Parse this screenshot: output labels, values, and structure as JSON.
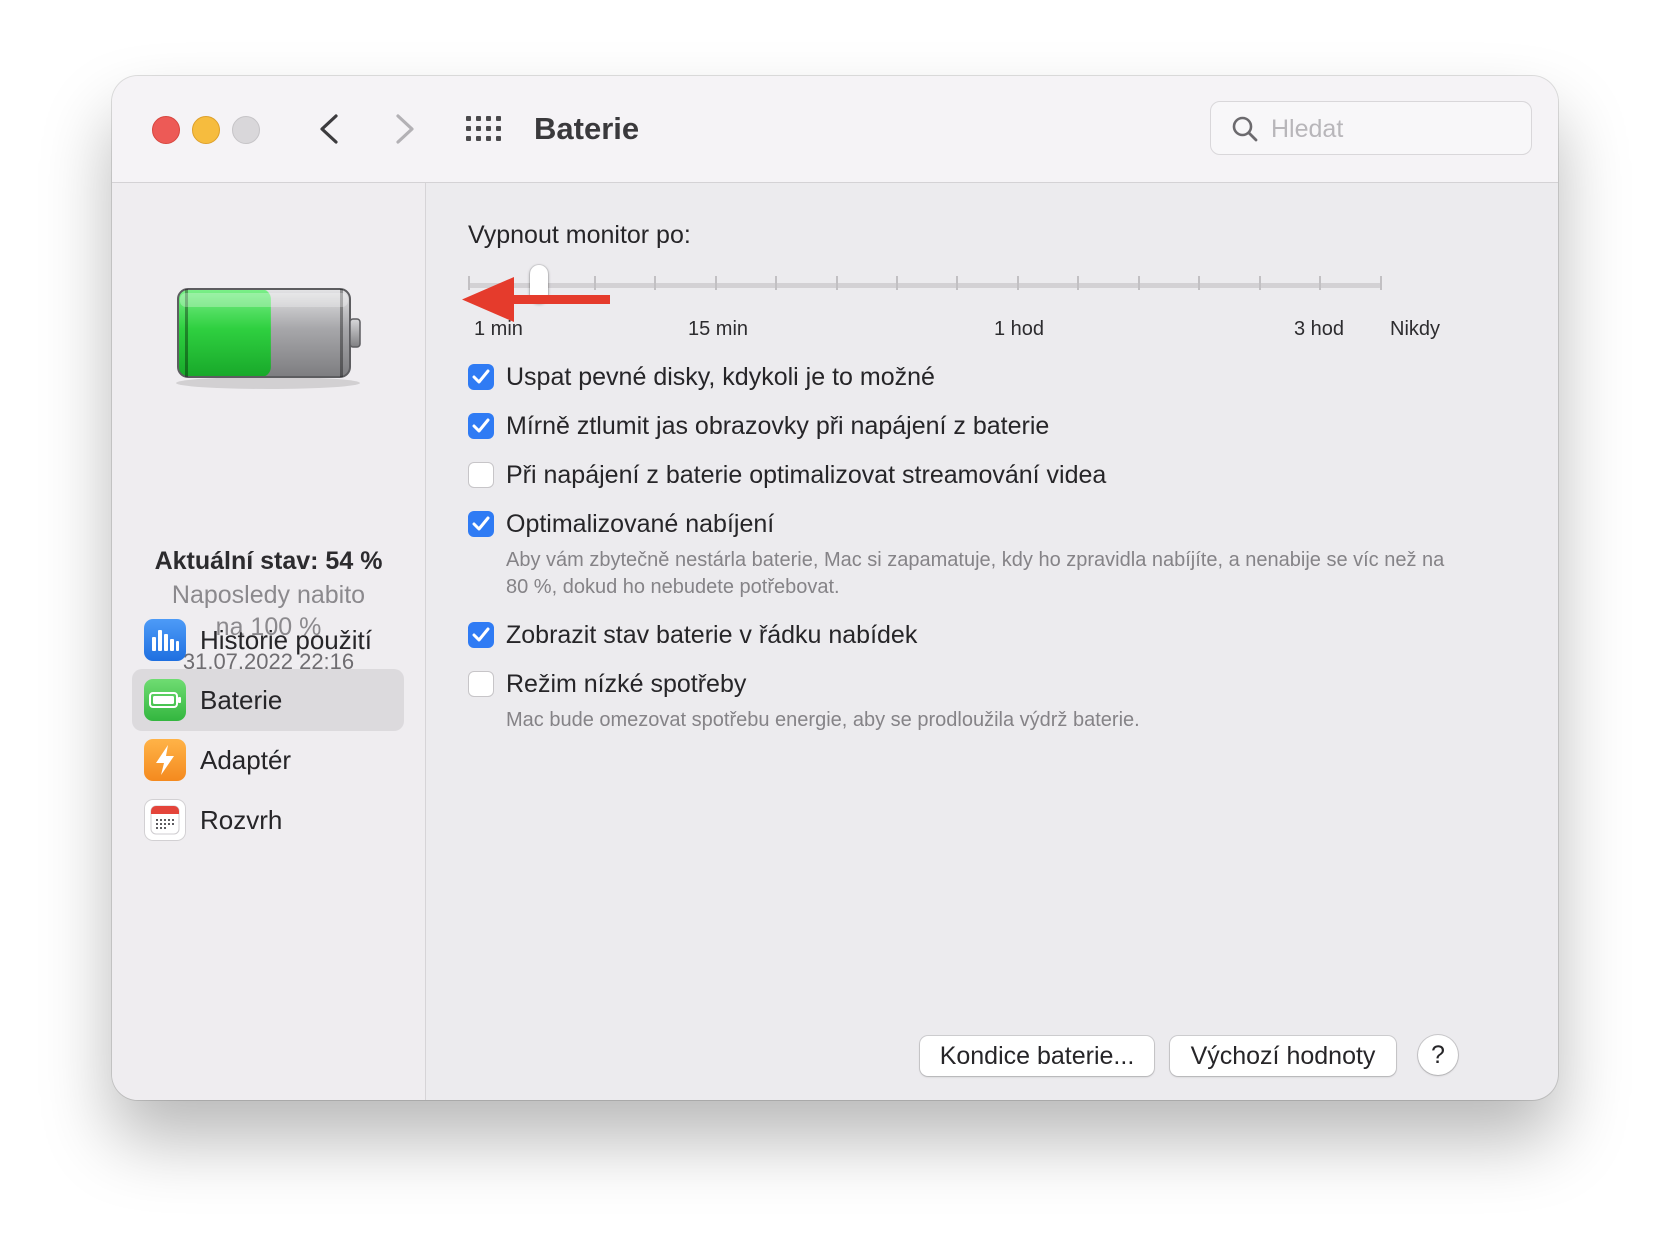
{
  "window": {
    "title": "Baterie",
    "search_placeholder": "Hledat"
  },
  "sidebar": {
    "status_title": "Aktuální stav: 54 %",
    "last_charged_line1": "Naposledy nabito",
    "last_charged_line2": "na 100 %",
    "last_charged_date": "31.07.2022 22:16",
    "battery_level_percent": 54,
    "items": [
      {
        "label": "Historie použití",
        "icon": "bar-chart-icon",
        "active": false
      },
      {
        "label": "Baterie",
        "icon": "battery-icon",
        "active": true
      },
      {
        "label": "Adaptér",
        "icon": "lightning-bolt-icon",
        "active": false
      },
      {
        "label": "Rozvrh",
        "icon": "calendar-icon",
        "active": false
      }
    ]
  },
  "display_off": {
    "title": "Vypnout monitor po:",
    "tick_labels": [
      "1 min",
      "15 min",
      "1 hod",
      "3 hod",
      "Nikdy"
    ],
    "selected_value": "2 min"
  },
  "options": [
    {
      "label": "Uspat pevné disky, kdykoli je to možné",
      "checked": true,
      "description": ""
    },
    {
      "label": "Mírně ztlumit jas obrazovky při napájení z baterie",
      "checked": true,
      "description": ""
    },
    {
      "label": "Při napájení z baterie optimalizovat streamování videa",
      "checked": false,
      "description": ""
    },
    {
      "label": "Optimalizované nabíjení",
      "checked": true,
      "description": "Aby vám zbytečně nestárla baterie, Mac si zapamatuje, kdy ho zpravidla nabíjíte, a nenabije se víc než na 80 %, dokud ho nebudete potřebovat."
    },
    {
      "label": "Zobrazit stav baterie v řádku nabídek",
      "checked": true,
      "description": ""
    },
    {
      "label": "Režim nízké spotřeby",
      "checked": false,
      "description": "Mac bude omezovat spotřebu energie, aby se prodloužila výdrž baterie."
    }
  ],
  "buttons": {
    "battery_health": "Kondice baterie...",
    "restore_defaults": "Výchozí hodnoty",
    "help": "?"
  },
  "colors": {
    "accent": "#2f7bf4",
    "close": "#ed5a56",
    "minimize": "#f6bc3e",
    "annotation_arrow": "#e53b2c"
  }
}
